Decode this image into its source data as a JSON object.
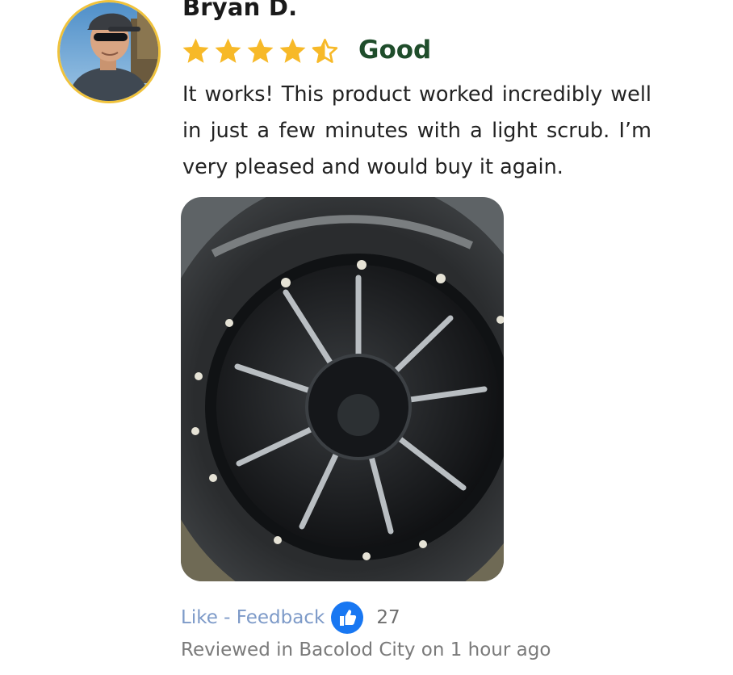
{
  "reviewer": {
    "name": "Bryan D.",
    "avatar_icon": "user-avatar-photo"
  },
  "rating": {
    "stars": 4.5,
    "max": 5,
    "label": "Good",
    "star_color": "#f7b928",
    "label_color": "#1f4d2b"
  },
  "review": {
    "text": "It works! This product worked incredibly well in just a few minutes with a light scrub. I’m very pleased and would buy it again.",
    "photo_icon": "review-photo-wheel"
  },
  "actions": {
    "like_label": "Like - Feedback",
    "like_icon": "thumbs-up-icon",
    "like_count": "27",
    "link_color": "#7d9ac8",
    "thumb_color": "#1877f2"
  },
  "meta": {
    "reviewed_text": "Reviewed in Bacolod City on 1 hour ago"
  }
}
